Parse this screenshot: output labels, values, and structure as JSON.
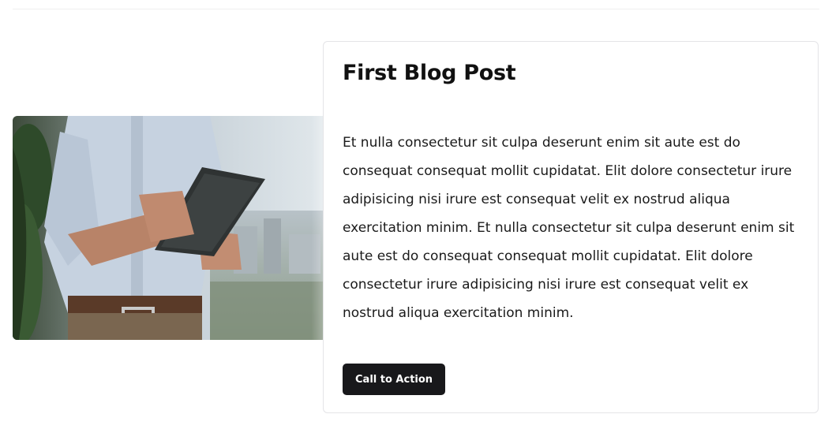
{
  "post": {
    "title": "First Blog Post",
    "body": "Et nulla consectetur sit culpa deserunt enim sit aute est do consequat consequat mollit cupidatat. Elit dolore consectetur irure adipisicing nisi irure est consequat velit ex nostrud aliqua exercitation minim. Et nulla consectetur sit culpa deserunt enim sit aute est do consequat consequat mollit cupidatat. Elit dolore consectetur irure adipisicing nisi irure est consequat velit ex nostrud aliqua exercitation minim.",
    "cta_label": "Call to Action"
  },
  "colors": {
    "button_bg": "#18181b",
    "button_text": "#ffffff",
    "card_border": "#e4e4e7",
    "heading": "#111111"
  },
  "image": {
    "subject": "man-holding-tablet-photo"
  }
}
